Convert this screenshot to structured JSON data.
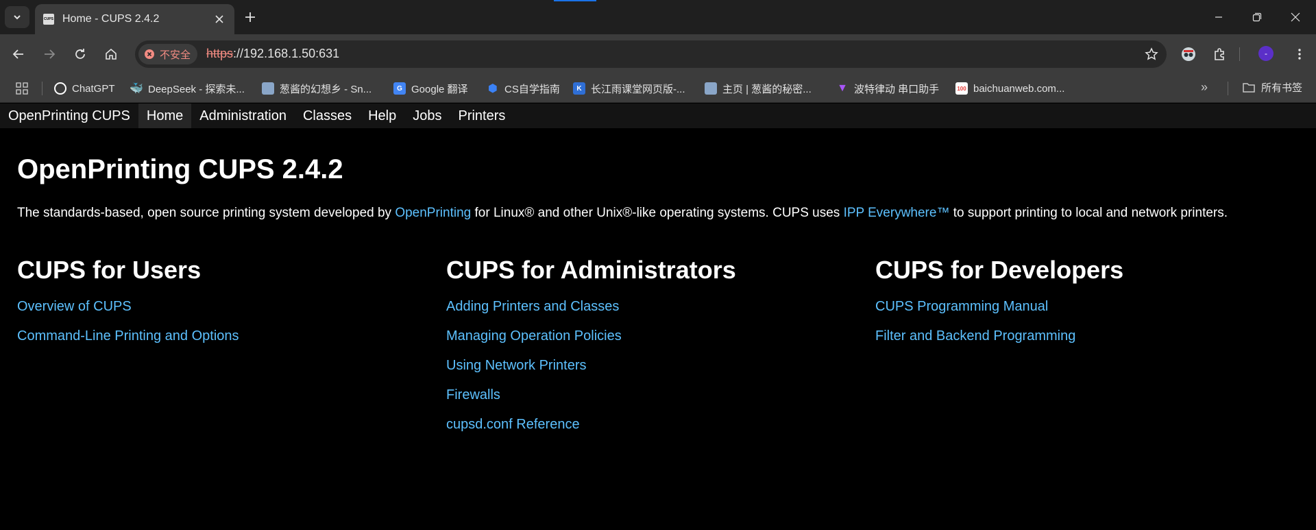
{
  "browser": {
    "tab": {
      "favicon_text": "CUPS",
      "title": "Home - CUPS 2.4.2"
    },
    "address": {
      "security_label": "不安全",
      "url_scheme": "https",
      "url_rest": "://192.168.1.50:631"
    },
    "profile_initial": "-",
    "bookmarks": [
      {
        "label": "ChatGPT",
        "icon": "chatgpt-icon",
        "color": "#ffffff"
      },
      {
        "label": "DeepSeek - 探索未...",
        "icon": "deepseek-icon",
        "color": "#4d6bfe"
      },
      {
        "label": "葱酱的幻想乡 - Sn...",
        "icon": "avatar-icon",
        "color": "#8aa6c8"
      },
      {
        "label": "Google 翻译",
        "icon": "google-translate-icon",
        "color": "#4285f4"
      },
      {
        "label": "CS自学指南",
        "icon": "cube-icon",
        "color": "#3b82f6"
      },
      {
        "label": "长江雨课堂网页版-...",
        "icon": "yuketang-icon",
        "color": "#2f6fd6"
      },
      {
        "label": "主页 | 葱酱的秘密...",
        "icon": "avatar-icon",
        "color": "#8aa6c8"
      },
      {
        "label": "波特律动 串口助手",
        "icon": "vite-icon",
        "color": "#a855f7"
      },
      {
        "label": "baichuanweb.com...",
        "icon": "baichuan-icon",
        "color": "#ffffff"
      }
    ],
    "bookmarks_folder": "所有书签"
  },
  "cups": {
    "nav": [
      "OpenPrinting CUPS",
      "Home",
      "Administration",
      "Classes",
      "Help",
      "Jobs",
      "Printers"
    ],
    "title": "OpenPrinting CUPS 2.4.2",
    "intro": {
      "part1": "The standards-based, open source printing system developed by ",
      "link1": "OpenPrinting",
      "part2": " for Linux® and other Unix®-like operating systems. CUPS uses ",
      "link2": "IPP Everywhere™",
      "part3": " to support printing to local and network printers."
    },
    "users": {
      "heading": "CUPS for Users",
      "links": [
        "Overview of CUPS",
        "Command-Line Printing and Options"
      ]
    },
    "admins": {
      "heading": "CUPS for Administrators",
      "links": [
        "Adding Printers and Classes",
        "Managing Operation Policies",
        "Using Network Printers",
        "Firewalls",
        "cupsd.conf Reference"
      ]
    },
    "developers": {
      "heading": "CUPS for Developers",
      "links": [
        "CUPS Programming Manual",
        "Filter and Backend Programming"
      ]
    }
  },
  "colors": {
    "link": "#5dc1ff",
    "nav_bg": "#141414",
    "nav_active": "#262626",
    "page_bg": "#000000"
  }
}
